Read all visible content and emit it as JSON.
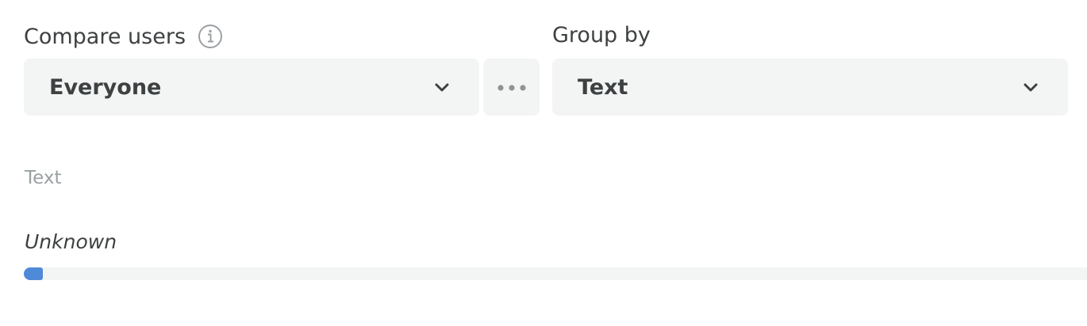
{
  "compare": {
    "label": "Compare users",
    "info_icon": "info-icon",
    "selected": "Everyone",
    "more_icon": "more-dots-icon"
  },
  "group_by": {
    "label": "Group by",
    "selected": "Text"
  },
  "breakdown": {
    "title": "Text",
    "rows": [
      {
        "label": "Unknown",
        "fraction": 0.018,
        "color": "#4f8ad9"
      }
    ]
  }
}
